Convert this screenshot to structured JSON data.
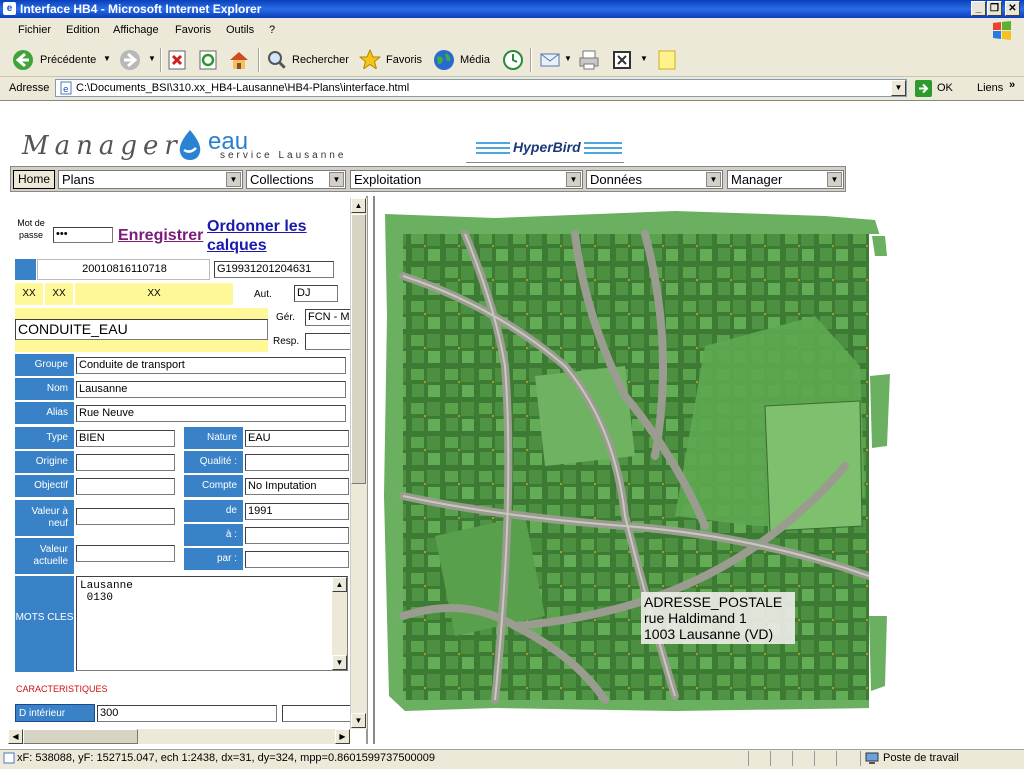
{
  "window": {
    "title": "Interface HB4 - Microsoft Internet Explorer",
    "buttons": [
      "_",
      "❐",
      "✕"
    ]
  },
  "menu": [
    "Fichier",
    "Edition",
    "Affichage",
    "Favoris",
    "Outils",
    "?"
  ],
  "toolbar": {
    "back": "Précédente",
    "search": "Rechercher",
    "favorites": "Favoris",
    "media": "Média"
  },
  "address": {
    "label": "Adresse",
    "url": "C:\\Documents_BSI\\310.xx_HB4-Lausanne\\HB4-Plans\\interface.html",
    "go": "OK",
    "links": "Liens"
  },
  "header": {
    "manager": "Manager",
    "eau": "eau",
    "service": "service Lausanne",
    "hyperbird": "HyperBird"
  },
  "nav": {
    "home": "Home",
    "selects": [
      "Plans",
      "Collections",
      "Exploitation",
      "Données",
      "Manager"
    ]
  },
  "form": {
    "password_label": "Mot de passe",
    "password_value": "•••",
    "save_link": "Enregistrer",
    "layers_link": "Ordonner les calques",
    "id1": "20010816110718",
    "id2": "G19931201204631",
    "xx1": "XX",
    "xx2": "XX",
    "xx3": "XX",
    "aut_label": "Aut.",
    "aut_value": "DJ",
    "title": "CONDUITE_EAU",
    "ger_label": "Gér.",
    "ger_value": "FCN  -  M",
    "resp_label": "Resp.",
    "groupe_label": "Groupe",
    "groupe_value": "Conduite de transport",
    "nom_label": "Nom",
    "nom_value": "Lausanne",
    "alias_label": "Alias",
    "alias_value": "Rue Neuve",
    "type_label": "Type",
    "type_value": "BIEN",
    "nature_label": "Nature",
    "nature_value": "EAU",
    "origine_label": "Origine",
    "qualite_label": "Qualité :",
    "objectif_label": "Objectif",
    "compte_label": "Compte",
    "compte_value": "No Imputation",
    "valeur_neuf_label": "Valeur à neuf",
    "de_label": "de",
    "de_value": "1991",
    "a_label": "à :",
    "valeur_actuelle_label": "Valeur actuelle",
    "par_label": "par :",
    "mots_cles_label": "MOTS CLES",
    "mots_cles_value": "Lausanne\n 0130",
    "caracteristiques": "CARACTERISTIQUES",
    "d_interieur_label": "D intérieur",
    "d_interieur_value": "300"
  },
  "map": {
    "address_lines": [
      "ADRESSE_POSTALE",
      "rue Haldimand 1",
      "1003 Lausanne (VD)"
    ]
  },
  "status": {
    "text": "xF: 538088, yF: 152715.047, ech 1:2438, dx=31, dy=324, mpp=0.8601599737500009",
    "zone": "Poste de travail"
  },
  "colors": {
    "label_blue": "#3a82c8",
    "highlight_yellow": "#fff899",
    "map_green": "#4f9a48"
  }
}
